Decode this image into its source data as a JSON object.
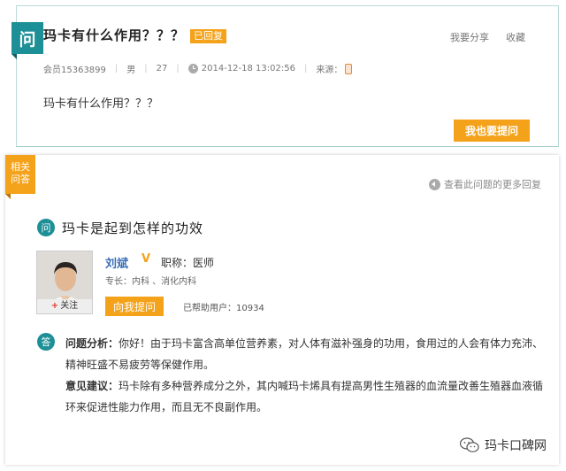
{
  "question": {
    "badge": "问",
    "title": "玛卡有什么作用？？？",
    "status": "已回复",
    "share_label": "我要分享",
    "favorite_label": "收藏",
    "member": "会员15363899",
    "gender": "男",
    "age": "27",
    "datetime": "2014-12-18 13:02:56",
    "source_label": "来源：",
    "body": "玛卡有什么作用？？？",
    "ask_too_label": "我也要提问"
  },
  "related": {
    "tag": "相关问答",
    "more_label": "查看此问题的更多回复",
    "q_badge": "问",
    "question_title": "玛卡是起到怎样的功效",
    "doctor": {
      "name": "刘斌",
      "vip_mark": "V",
      "title": "职称：医师",
      "specialty": "专长：内科 、消化内科",
      "follow_label": "关注",
      "ask_label": "向我提问",
      "helped": "已帮助用户：10934"
    },
    "answer_badge": "答",
    "analysis_label": "问题分析：",
    "analysis_text": "你好！由于玛卡富含高单位营养素，对人体有滋补强身的功用，食用过的人会有体力充沛、精神旺盛不易疲劳等保健作用。",
    "advice_label": "意见建议：",
    "advice_text": "玛卡除有多种营养成分之外，其内喊玛卡烯具有提高男性生殖器的血流量改善生殖器血液循环来促进性能力作用，而且无不良副作用。"
  },
  "watermark": "玛卡口碑网",
  "colors": {
    "teal": "#1d8f96",
    "orange": "#f4a21a",
    "link_blue": "#3a6fb7"
  }
}
